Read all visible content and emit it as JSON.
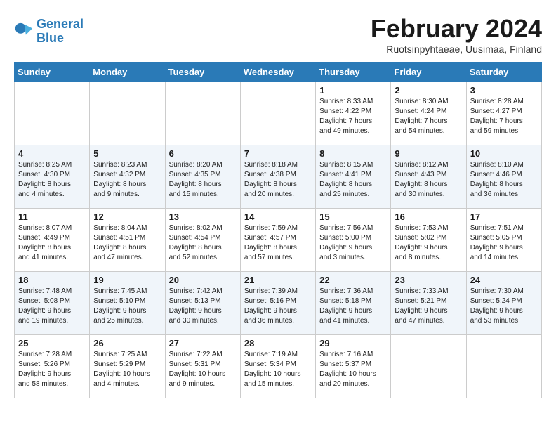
{
  "header": {
    "logo_line1": "General",
    "logo_line2": "Blue",
    "month_title": "February 2024",
    "location": "Ruotsinpyhtaeae, Uusimaa, Finland"
  },
  "days_of_week": [
    "Sunday",
    "Monday",
    "Tuesday",
    "Wednesday",
    "Thursday",
    "Friday",
    "Saturday"
  ],
  "weeks": [
    [
      {
        "day": "",
        "info": ""
      },
      {
        "day": "",
        "info": ""
      },
      {
        "day": "",
        "info": ""
      },
      {
        "day": "",
        "info": ""
      },
      {
        "day": "1",
        "info": "Sunrise: 8:33 AM\nSunset: 4:22 PM\nDaylight: 7 hours\nand 49 minutes."
      },
      {
        "day": "2",
        "info": "Sunrise: 8:30 AM\nSunset: 4:24 PM\nDaylight: 7 hours\nand 54 minutes."
      },
      {
        "day": "3",
        "info": "Sunrise: 8:28 AM\nSunset: 4:27 PM\nDaylight: 7 hours\nand 59 minutes."
      }
    ],
    [
      {
        "day": "4",
        "info": "Sunrise: 8:25 AM\nSunset: 4:30 PM\nDaylight: 8 hours\nand 4 minutes."
      },
      {
        "day": "5",
        "info": "Sunrise: 8:23 AM\nSunset: 4:32 PM\nDaylight: 8 hours\nand 9 minutes."
      },
      {
        "day": "6",
        "info": "Sunrise: 8:20 AM\nSunset: 4:35 PM\nDaylight: 8 hours\nand 15 minutes."
      },
      {
        "day": "7",
        "info": "Sunrise: 8:18 AM\nSunset: 4:38 PM\nDaylight: 8 hours\nand 20 minutes."
      },
      {
        "day": "8",
        "info": "Sunrise: 8:15 AM\nSunset: 4:41 PM\nDaylight: 8 hours\nand 25 minutes."
      },
      {
        "day": "9",
        "info": "Sunrise: 8:12 AM\nSunset: 4:43 PM\nDaylight: 8 hours\nand 30 minutes."
      },
      {
        "day": "10",
        "info": "Sunrise: 8:10 AM\nSunset: 4:46 PM\nDaylight: 8 hours\nand 36 minutes."
      }
    ],
    [
      {
        "day": "11",
        "info": "Sunrise: 8:07 AM\nSunset: 4:49 PM\nDaylight: 8 hours\nand 41 minutes."
      },
      {
        "day": "12",
        "info": "Sunrise: 8:04 AM\nSunset: 4:51 PM\nDaylight: 8 hours\nand 47 minutes."
      },
      {
        "day": "13",
        "info": "Sunrise: 8:02 AM\nSunset: 4:54 PM\nDaylight: 8 hours\nand 52 minutes."
      },
      {
        "day": "14",
        "info": "Sunrise: 7:59 AM\nSunset: 4:57 PM\nDaylight: 8 hours\nand 57 minutes."
      },
      {
        "day": "15",
        "info": "Sunrise: 7:56 AM\nSunset: 5:00 PM\nDaylight: 9 hours\nand 3 minutes."
      },
      {
        "day": "16",
        "info": "Sunrise: 7:53 AM\nSunset: 5:02 PM\nDaylight: 9 hours\nand 8 minutes."
      },
      {
        "day": "17",
        "info": "Sunrise: 7:51 AM\nSunset: 5:05 PM\nDaylight: 9 hours\nand 14 minutes."
      }
    ],
    [
      {
        "day": "18",
        "info": "Sunrise: 7:48 AM\nSunset: 5:08 PM\nDaylight: 9 hours\nand 19 minutes."
      },
      {
        "day": "19",
        "info": "Sunrise: 7:45 AM\nSunset: 5:10 PM\nDaylight: 9 hours\nand 25 minutes."
      },
      {
        "day": "20",
        "info": "Sunrise: 7:42 AM\nSunset: 5:13 PM\nDaylight: 9 hours\nand 30 minutes."
      },
      {
        "day": "21",
        "info": "Sunrise: 7:39 AM\nSunset: 5:16 PM\nDaylight: 9 hours\nand 36 minutes."
      },
      {
        "day": "22",
        "info": "Sunrise: 7:36 AM\nSunset: 5:18 PM\nDaylight: 9 hours\nand 41 minutes."
      },
      {
        "day": "23",
        "info": "Sunrise: 7:33 AM\nSunset: 5:21 PM\nDaylight: 9 hours\nand 47 minutes."
      },
      {
        "day": "24",
        "info": "Sunrise: 7:30 AM\nSunset: 5:24 PM\nDaylight: 9 hours\nand 53 minutes."
      }
    ],
    [
      {
        "day": "25",
        "info": "Sunrise: 7:28 AM\nSunset: 5:26 PM\nDaylight: 9 hours\nand 58 minutes."
      },
      {
        "day": "26",
        "info": "Sunrise: 7:25 AM\nSunset: 5:29 PM\nDaylight: 10 hours\nand 4 minutes."
      },
      {
        "day": "27",
        "info": "Sunrise: 7:22 AM\nSunset: 5:31 PM\nDaylight: 10 hours\nand 9 minutes."
      },
      {
        "day": "28",
        "info": "Sunrise: 7:19 AM\nSunset: 5:34 PM\nDaylight: 10 hours\nand 15 minutes."
      },
      {
        "day": "29",
        "info": "Sunrise: 7:16 AM\nSunset: 5:37 PM\nDaylight: 10 hours\nand 20 minutes."
      },
      {
        "day": "",
        "info": ""
      },
      {
        "day": "",
        "info": ""
      }
    ]
  ]
}
